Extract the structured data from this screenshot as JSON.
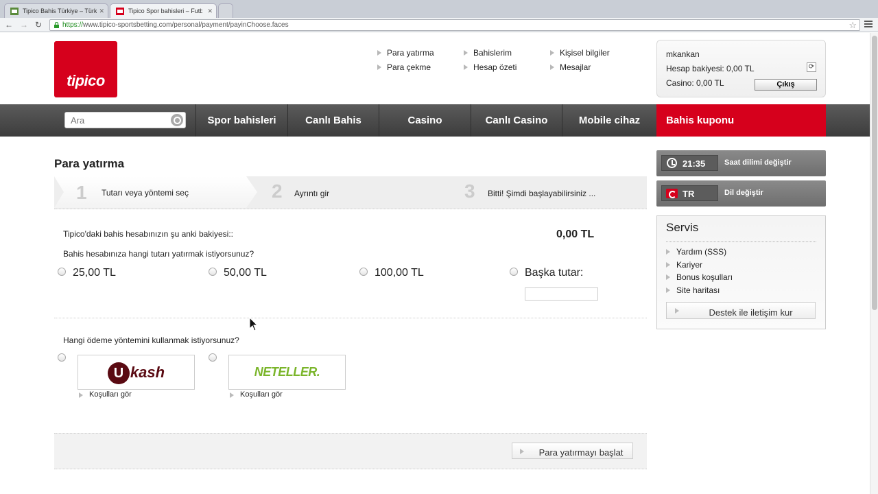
{
  "browser": {
    "tabs": [
      {
        "title": "Tipico Bahis Türkiye – Türkçe"
      },
      {
        "title": "Tipico Spor bahisleri – Futbol"
      }
    ],
    "url_scheme": "https://",
    "url_rest": "www.tipico-sportsbetting.com/personal/payment/payinChoose.faces"
  },
  "header": {
    "logo_text": "tipico",
    "links": {
      "deposit": "Para yatırma",
      "withdraw": "Para çekme",
      "my_bets": "Bahislerim",
      "account_summary": "Hesap özeti",
      "personal_info": "Kişisel bilgiler",
      "messages": "Mesajlar"
    },
    "user": {
      "name": "mkankan",
      "account_balance": "Hesap bakiyesi: 0,00 TL",
      "casino_balance": "Casino: 0,00 TL",
      "logout": "Çıkış"
    }
  },
  "nav": {
    "search_placeholder": "Ara",
    "items": [
      "Spor bahisleri",
      "Canlı Bahis",
      "Casino",
      "Canlı Casino",
      "Mobile cihaz"
    ],
    "coupon": "Bahis kuponu"
  },
  "main": {
    "title": "Para yatırma",
    "steps": [
      {
        "num": "1",
        "label": "Tutarı veya yöntemi seç"
      },
      {
        "num": "2",
        "label": "Ayrıntı gir"
      },
      {
        "num": "3",
        "label": "Bitti! Şimdi başlayabilirsiniz ..."
      }
    ],
    "balance_label": "Tipico'daki bahis hesabınızın şu anki bakiyesi::",
    "balance_value": "0,00 TL",
    "amount_question": "Bahis hesabınıza hangi tutarı yatırmak istiyorsunuz?",
    "amounts": [
      "25,00 TL",
      "50,00 TL",
      "100,00 TL"
    ],
    "other_amount": "Başka tutar:",
    "method_question": "Hangi ödeme yöntemini kullanmak istiyorsunuz?",
    "methods": [
      {
        "name": "ukash",
        "conditions": "Koşulları gör"
      },
      {
        "name": "NETELLER.",
        "conditions": "Koşulları gör"
      }
    ],
    "start_button": "Para yatırmayı başlat"
  },
  "sidebar": {
    "time": "21:35",
    "time_label": "Saat dilimi değiştir",
    "lang": "TR",
    "lang_label": "Dil değiştir",
    "service_title": "Servis",
    "service_items": [
      "Yardım (SSS)",
      "Kariyer",
      "Bonus koşulları",
      "Site haritası"
    ],
    "support_button": "Destek ile iletişim kur"
  },
  "colors": {
    "brand_red": "#d6001c",
    "nav_dark": "#4a4a4a"
  }
}
